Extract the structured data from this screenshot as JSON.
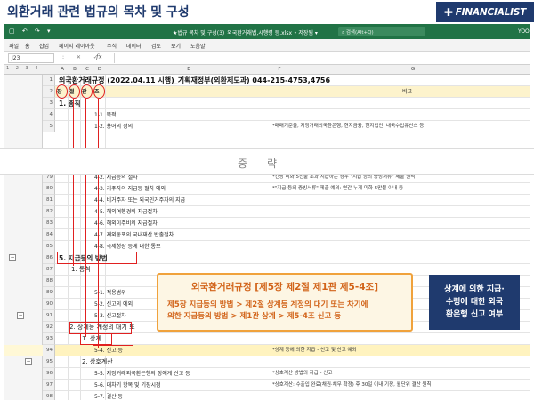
{
  "slide": {
    "title": "외환거래 관련 법규의 목차 및 구성",
    "brand": "FINANCIALIST"
  },
  "excel": {
    "titlebar": {
      "quick_access": "▢ ↶ ↷ ▾",
      "doc_title": "★법규 목차 및 구성(3)_외국환거래법,시행령 등.xlsx • 저장됨 ▾",
      "search_placeholder": "검색(Alt+Q)",
      "user": "YOO"
    },
    "ribbon_tabs": [
      "파일",
      "홈",
      "삽입",
      "페이지 레이아웃",
      "수식",
      "데이터",
      "검토",
      "보기",
      "도움말"
    ],
    "namebox": "J23",
    "formula_icons": ":  ✕  ✓",
    "fx": "fx",
    "outline_levels": "1 2 3 4",
    "columns": [
      "A",
      "B",
      "C",
      "D",
      "E",
      "F",
      "G"
    ],
    "rows_top": [
      {
        "num": "1",
        "e": "외국환거래규정 (2022.04.11 시행)_기획재정부(외환제도과) 044-215-4753,4756",
        "f": ""
      },
      {
        "num": "2",
        "a": "장",
        "b": "절",
        "c": "관",
        "d": "조",
        "f": "",
        "g": "비고"
      },
      {
        "num": "3",
        "e": "1. 총칙",
        "f": ""
      },
      {
        "num": "4",
        "e": "1-1. 목적",
        "f": ""
      },
      {
        "num": "5",
        "e": "1-2. 용어의 정의",
        "f": "*매매기준율, 지정거래외국환은행, 현지금융, 현지법인, 내국수입유산스 등"
      }
    ],
    "band_text": "중략",
    "rows_bottom": [
      {
        "num": "79",
        "e": "4-2. 지급등의 절차",
        "f": "*건당 미화 5천불 초과 지급하는 경우 \"지급 등의 증빙서류\" 제출 원칙"
      },
      {
        "num": "80",
        "e": "4-3. 거주자의 지급등 절차 예외",
        "f": "*\"지급 등의 증빙서류\" 제출 예외: 연간 누계 미화 5만불 이내 등"
      },
      {
        "num": "81",
        "e": "4-4. 비거주자 또는 외국인거주자의 지급",
        "f": ""
      },
      {
        "num": "82",
        "e": "4-5. 해외여행경비 지급절차",
        "f": ""
      },
      {
        "num": "83",
        "e": "4-6. 해외이주비의 지급절차",
        "f": ""
      },
      {
        "num": "84",
        "e": "4-7. 재외동포의 국내재산 반출절차",
        "f": ""
      },
      {
        "num": "85",
        "e": "4-8. 국세청장 등에 대한 통보",
        "f": ""
      },
      {
        "num": "86",
        "e": "5. 지급등의 방법",
        "f": ""
      },
      {
        "num": "87",
        "e": "1. 통칙",
        "f": ""
      },
      {
        "num": "88",
        "e": "",
        "f": ""
      },
      {
        "num": "89",
        "e": "5-1. 적용범위",
        "f": ""
      },
      {
        "num": "90",
        "e": "5-2. 신고의 예외",
        "f": ""
      },
      {
        "num": "91",
        "e": "5-3. 신고절차",
        "f": ""
      },
      {
        "num": "92",
        "e": "2. 상계등 계정의 대기 또",
        "f": ""
      },
      {
        "num": "93",
        "e": "1. 상계",
        "f": ""
      },
      {
        "num": "94",
        "e": "5-4. 신고 등",
        "f": "*상계 등에 의한 지급 - 신고 및 신고 예외"
      },
      {
        "num": "95",
        "e": "2. 상호계산",
        "f": ""
      },
      {
        "num": "96",
        "e": "5-5. 지정거래외국환은행의 장에게 신고 등",
        "f": "*상호계산 방법의 지급 - 신고"
      },
      {
        "num": "97",
        "e": "5-6. 대차기 항목 및 기장시점",
        "f": "*상호계산: 수출입 완료(채권·채무 확정) 후 30일 이내 기장, 월단위 결산 원칙"
      },
      {
        "num": "98",
        "e": "5-7. 결산 등",
        "f": ""
      }
    ]
  },
  "callout": {
    "title": "외국환거래규정 [제5장 제2절 제1관 제5-4조]",
    "line1": "제5장 지급등의 방법 > 제2절 상계등 계정의 대기 또는 차기에",
    "line2": "의한 지급등의 방법 > 제1관 상계 > 제5-4조 신고 등"
  },
  "note": {
    "line1": "상계에 의한 지급·",
    "line2": "수령에 대한 외국",
    "line3": "환은행 신고 여부"
  },
  "colors": {
    "excel_green": "#217346",
    "accent_red": "#e02020",
    "callout_orange": "#f0a23c",
    "navy": "#1f3a6e"
  }
}
